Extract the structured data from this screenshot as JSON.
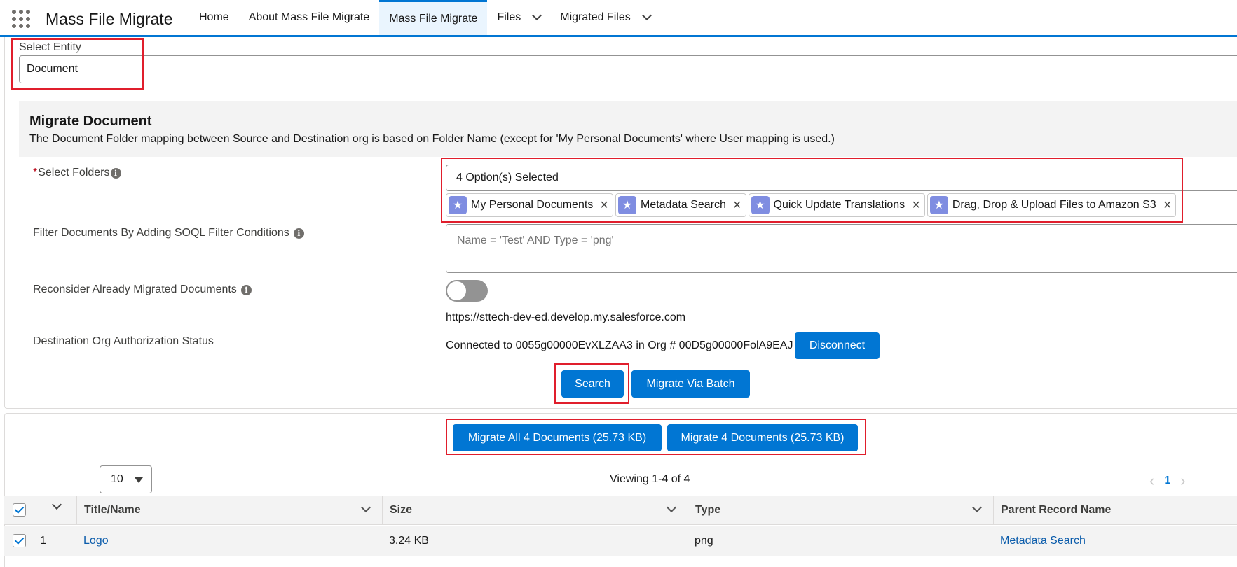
{
  "app": {
    "title": "Mass File Migrate"
  },
  "nav": {
    "home": "Home",
    "about": "About Mass File Migrate",
    "mass_file_migrate": "Mass File Migrate",
    "files": "Files",
    "migrated_files": "Migrated Files"
  },
  "entity": {
    "label": "Select Entity",
    "value": "Document"
  },
  "section": {
    "title": "Migrate Document",
    "description": "The Document Folder mapping between Source and Destination org is based on Folder Name (except for 'My Personal Documents' where User mapping is used.)"
  },
  "folders": {
    "required_mark": "*",
    "label": "Select Folders",
    "selected_text": "4 Option(s) Selected",
    "pills": [
      "My Personal Documents",
      "Metadata Search",
      "Quick Update Translations",
      "Drag, Drop & Upload Files to Amazon S3"
    ]
  },
  "filter": {
    "label": "Filter Documents By Adding SOQL Filter Conditions",
    "placeholder": "Name = 'Test' AND Type = 'png'"
  },
  "reconsider": {
    "label": "Reconsider Already Migrated Documents",
    "enabled": false
  },
  "destination": {
    "label": "Destination Org Authorization Status",
    "url": "https://sttech-dev-ed.develop.my.salesforce.com",
    "status": "Connected to 0055g00000EvXLZAA3 in Org # 00D5g00000FolA9EAJ",
    "disconnect_label": "Disconnect"
  },
  "actions": {
    "search_label": "Search",
    "migrate_batch_label": "Migrate Via Batch",
    "migrate_all_label": "Migrate All 4 Documents (25.73 KB)",
    "migrate_selected_label": "Migrate 4 Documents (25.73 KB)"
  },
  "table": {
    "page_size": "10",
    "viewing": "Viewing 1-4 of 4",
    "current_page": "1",
    "columns": [
      "Title/Name",
      "Size",
      "Type",
      "Parent Record Name"
    ],
    "rows": [
      {
        "index": "1",
        "title": "Logo",
        "size": "3.24 KB",
        "type": "png",
        "parent": "Metadata Search",
        "checked": true
      }
    ]
  },
  "colors": {
    "brand": "#0176d3",
    "highlight": "#e01e2c"
  }
}
